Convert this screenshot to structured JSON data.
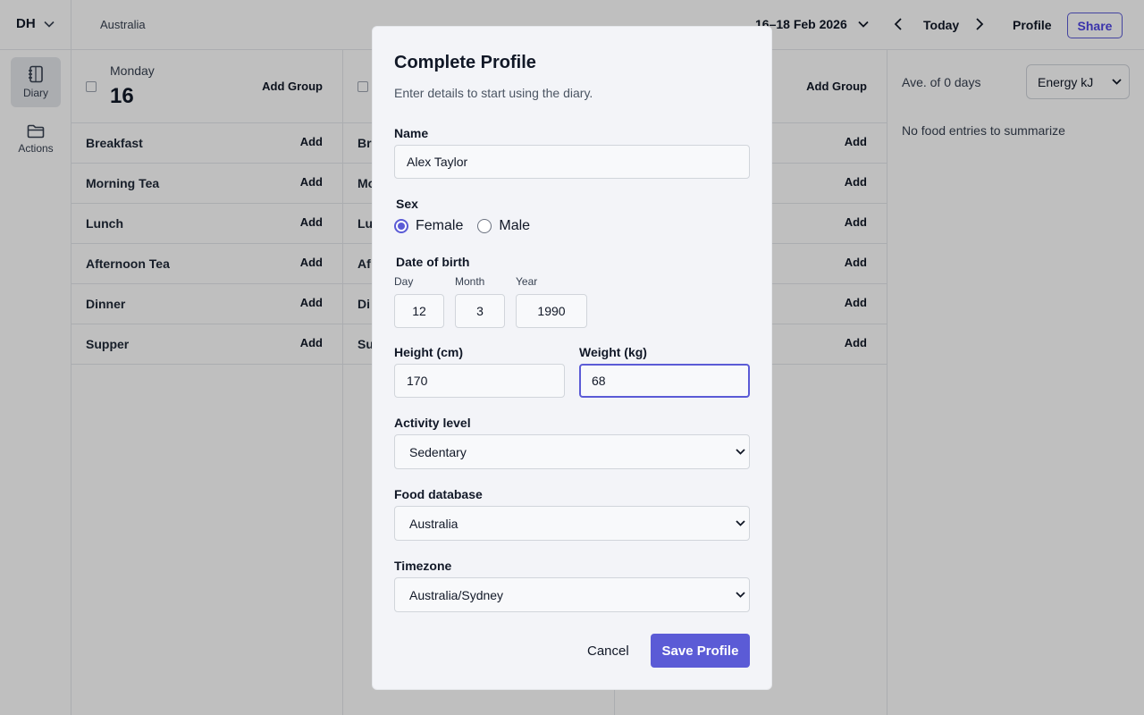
{
  "topbar": {
    "user_initials": "DH",
    "region": "Australia",
    "date_range": "16–18 Feb 2026",
    "today_label": "Today",
    "profile_label": "Profile",
    "share_label": "Share"
  },
  "sidebar": {
    "items": [
      {
        "label": "Diary",
        "icon": "notebook-icon",
        "active": true
      },
      {
        "label": "Actions",
        "icon": "folder-icon",
        "active": false
      }
    ]
  },
  "days": [
    {
      "weekday": "Monday",
      "date": "16",
      "add_group_label": "Add Group"
    },
    {
      "weekday": "",
      "date": "",
      "add_group_label": "Add Group"
    }
  ],
  "meals": [
    {
      "name": "Breakfast",
      "add_label": "Add"
    },
    {
      "name": "Morning Tea",
      "add_label": "Add"
    },
    {
      "name": "Lunch",
      "add_label": "Add"
    },
    {
      "name": "Afternoon Tea",
      "add_label": "Add"
    },
    {
      "name": "Dinner",
      "add_label": "Add"
    },
    {
      "name": "Supper",
      "add_label": "Add"
    }
  ],
  "col2_meal_fragments": [
    "Br",
    "Mo",
    "Lu",
    "Af",
    "Di",
    "Su"
  ],
  "summary": {
    "average_label": "Ave. of 0 days",
    "unit_select": "Energy kJ",
    "empty_text": "No food entries to summarize"
  },
  "modal": {
    "title": "Complete Profile",
    "subtitle": "Enter details to start using the diary.",
    "name_label": "Name",
    "name_value": "Alex Taylor",
    "sex_label": "Sex",
    "sex_options": [
      "Female",
      "Male"
    ],
    "sex_selected": "Female",
    "dob_label": "Date of birth",
    "dob_day_label": "Day",
    "dob_day": "12",
    "dob_month_label": "Month",
    "dob_month": "3",
    "dob_year_label": "Year",
    "dob_year": "1990",
    "height_label": "Height (cm)",
    "height_value": "170",
    "weight_label": "Weight (kg)",
    "weight_value": "68",
    "activity_label": "Activity level",
    "activity_value": "Sedentary",
    "food_db_label": "Food database",
    "food_db_value": "Australia",
    "timezone_label": "Timezone",
    "timezone_value": "Australia/Sydney",
    "cancel_label": "Cancel",
    "save_label": "Save Profile"
  },
  "colors": {
    "accent": "#5b5bd6",
    "overlay": "rgba(0,0,0,0.25)"
  }
}
